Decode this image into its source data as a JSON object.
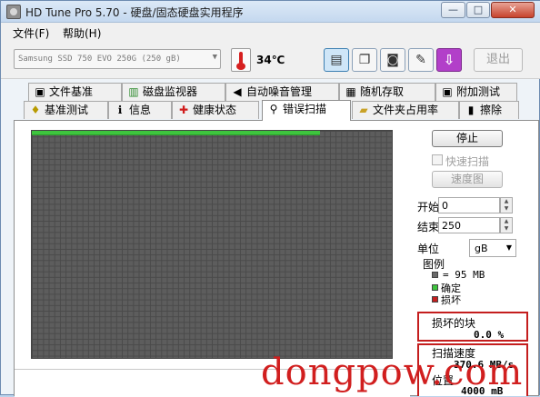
{
  "window": {
    "title": "HD Tune Pro 5.70 - 硬盘/固态硬盘实用程序"
  },
  "titlebar": {
    "minimize": "—",
    "maximize": "□",
    "close": "✕"
  },
  "menu": [
    {
      "label": "文件(F)"
    },
    {
      "label": "帮助(H)"
    }
  ],
  "toolbar": {
    "drive": "Samsung SSD 750 EVO 250G (250 gB)",
    "temperature": "34℃",
    "exit_label": "退出"
  },
  "tabs_row1": [
    {
      "label": "文件基准",
      "icon": "file-benchmark-icon"
    },
    {
      "label": "磁盘监视器",
      "icon": "disk-monitor-icon"
    },
    {
      "label": "自动噪音管理",
      "icon": "speaker-icon"
    },
    {
      "label": "随机存取",
      "icon": "random-access-icon"
    },
    {
      "label": "附加测试",
      "icon": "extra-tests-icon"
    }
  ],
  "tabs_row2": [
    {
      "label": "基准测试",
      "icon": "benchmark-bulb-icon"
    },
    {
      "label": "信息",
      "icon": "info-icon"
    },
    {
      "label": "健康状态",
      "icon": "health-cross-icon"
    },
    {
      "label": "错误扫描",
      "icon": "magnifier-icon",
      "active": true
    },
    {
      "label": "文件夹占用率",
      "icon": "folder-icon"
    },
    {
      "label": "擦除",
      "icon": "trash-icon"
    }
  ],
  "scan": {
    "stop_button": "停止",
    "quick_scan_label": "快速扫描",
    "speed_map_button": "速度图",
    "start_label": "开始",
    "start_value": "0",
    "end_label": "结束",
    "end_value": "250",
    "unit_label": "单位",
    "unit_value": "gB",
    "progress_fraction": 0.8
  },
  "legend": {
    "title": "图例",
    "block_size": "= 95 MB",
    "ok_label": "确定",
    "damaged_label": "损坏",
    "colors": {
      "block": "#6a6a6a",
      "ok": "#3ec43e",
      "damaged": "#c41e1e"
    }
  },
  "stats": {
    "damaged_blocks_label": "损坏的块",
    "damaged_blocks_value": "0.0 %",
    "scan_speed_label": "扫描速度",
    "scan_speed_value": "370.6 MB/s",
    "position_label": "位置",
    "position_value": "4000 mB"
  },
  "watermark": "dongpow.com"
}
